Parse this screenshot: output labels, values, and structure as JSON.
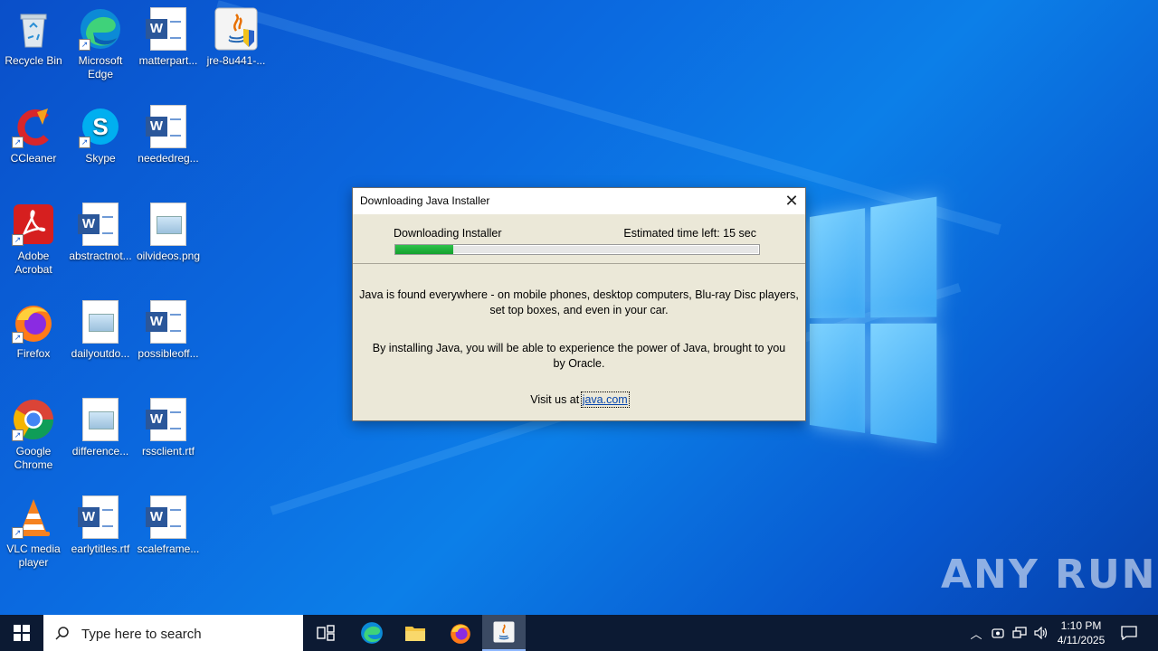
{
  "desktop_icons": [
    {
      "id": "recycle-bin",
      "label": "Recycle Bin"
    },
    {
      "id": "edge",
      "label": "Microsoft Edge"
    },
    {
      "id": "matterpart",
      "label": "matterpart..."
    },
    {
      "id": "jre",
      "label": "jre-8u441-..."
    },
    {
      "id": "ccleaner",
      "label": "CCleaner"
    },
    {
      "id": "skype",
      "label": "Skype"
    },
    {
      "id": "neededreg",
      "label": "neededreg..."
    },
    {
      "id": "acrobat",
      "label": "Adobe Acrobat"
    },
    {
      "id": "abstractnot",
      "label": "abstractnot..."
    },
    {
      "id": "oilvideos",
      "label": "oilvideos.png"
    },
    {
      "id": "firefox",
      "label": "Firefox"
    },
    {
      "id": "dailyoutdo",
      "label": "dailyoutdo..."
    },
    {
      "id": "possibleoff",
      "label": "possibleoff..."
    },
    {
      "id": "chrome",
      "label": "Google Chrome"
    },
    {
      "id": "difference",
      "label": "difference..."
    },
    {
      "id": "rssclient",
      "label": "rssclient.rtf"
    },
    {
      "id": "vlc",
      "label": "VLC media player"
    },
    {
      "id": "earlytitles",
      "label": "earlytitles.rtf"
    },
    {
      "id": "scaleframe",
      "label": "scaleframe..."
    }
  ],
  "dialog": {
    "title": "Downloading Java Installer",
    "status_label": "Downloading Installer",
    "eta": "Estimated time left: 15 sec",
    "progress_fraction": 0.16,
    "message1": "Java is found everywhere - on mobile phones, desktop computers, Blu-ray Disc players, set top boxes, and even in your car.",
    "message2": "By installing Java, you will be able to experience the power of Java, brought to you by Oracle.",
    "visit_prefix": "Visit us at ",
    "visit_link": "java.com"
  },
  "taskbar": {
    "search_placeholder": "Type here to search",
    "time": "1:10 PM",
    "date": "4/11/2025"
  },
  "watermark": "ANY RUN",
  "colors": {
    "progress_fill": "#14a02e",
    "taskbar": "#0c1a33",
    "link": "#0645ad"
  }
}
